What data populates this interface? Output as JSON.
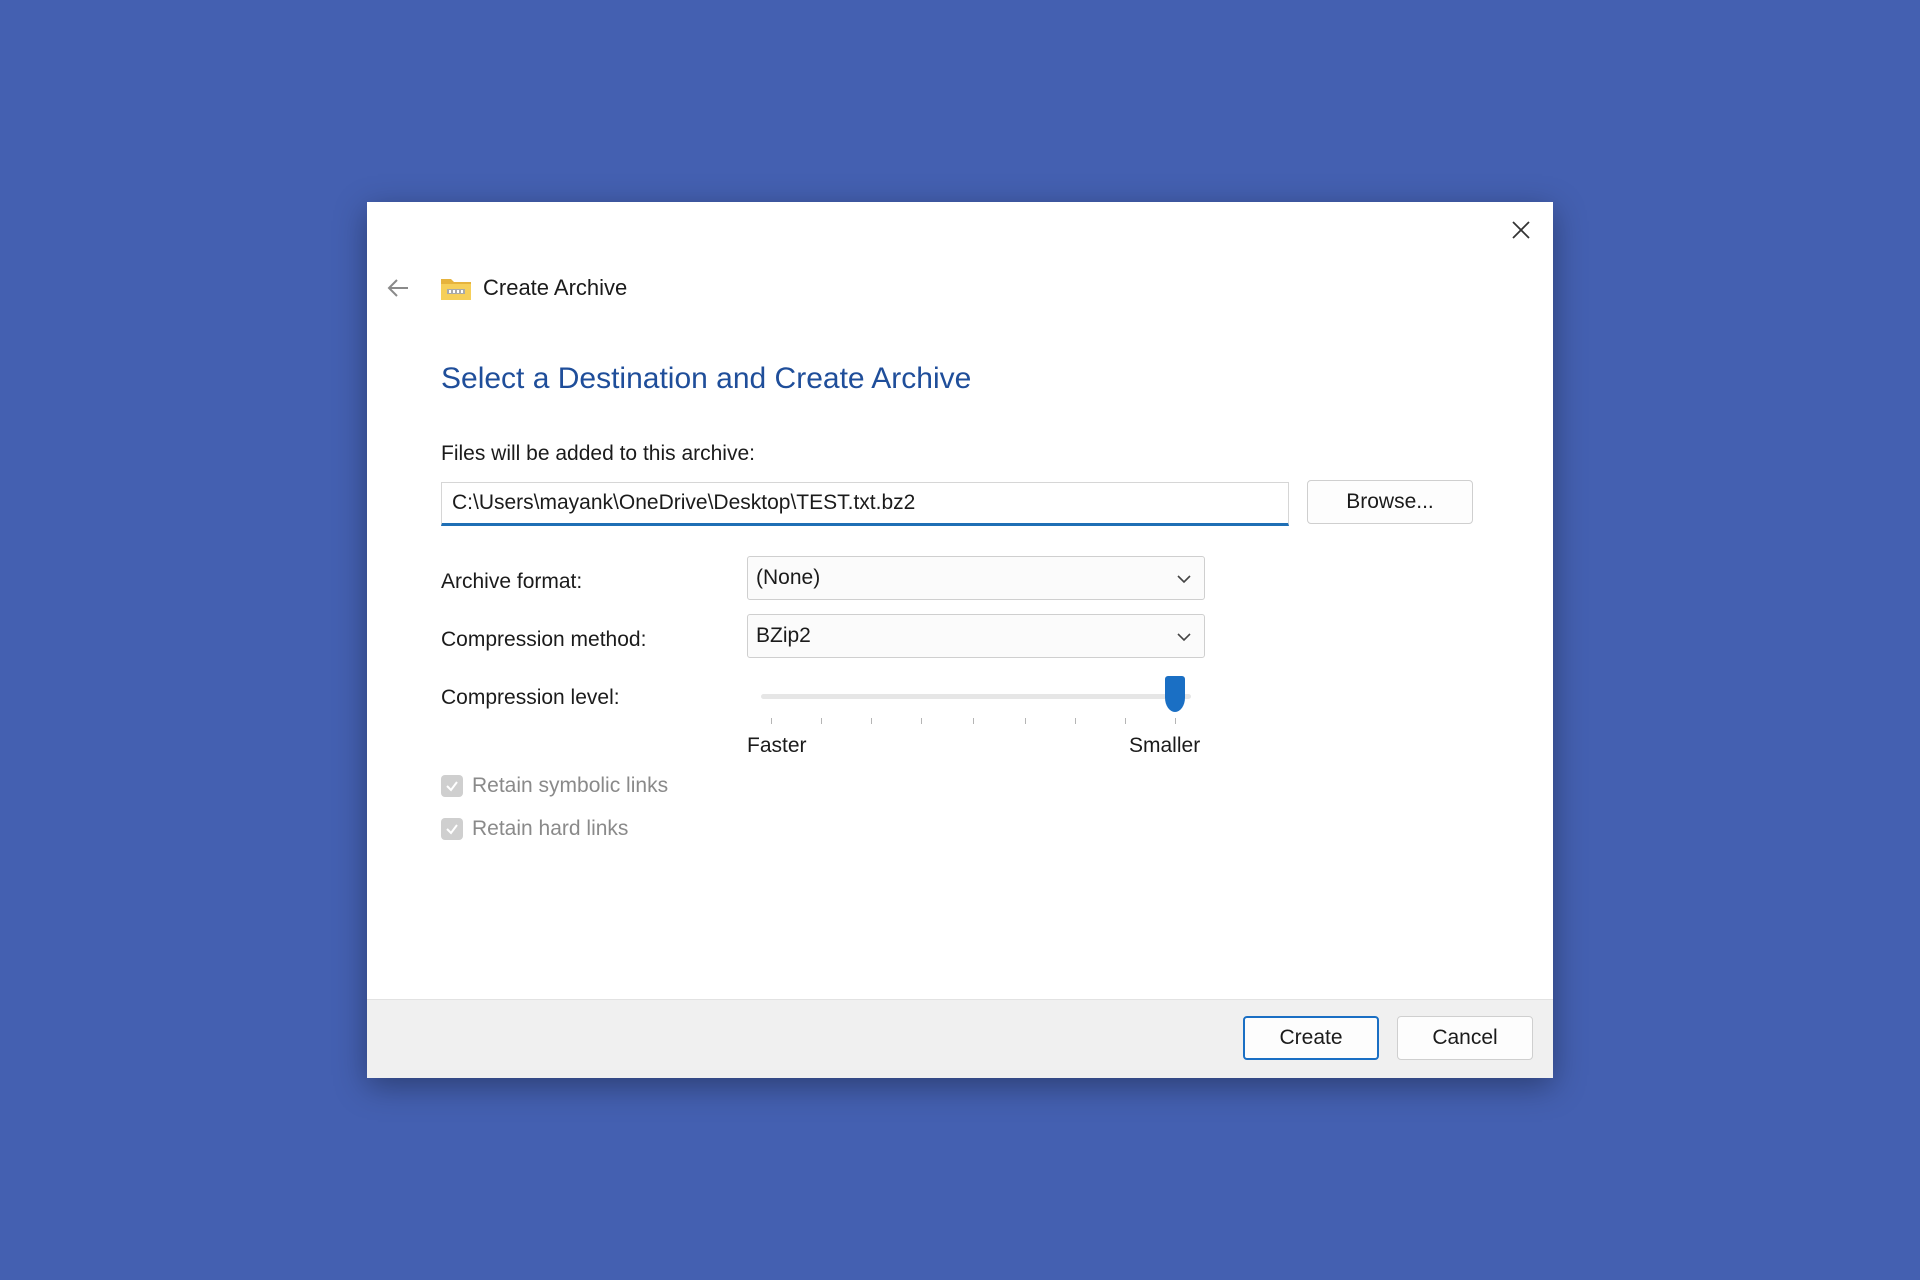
{
  "dialog": {
    "title": "Create Archive",
    "heading": "Select a Destination and Create Archive"
  },
  "destination": {
    "label": "Files will be added to this archive:",
    "path": "C:\\Users\\mayank\\OneDrive\\Desktop\\TEST.txt.bz2",
    "browse_label": "Browse..."
  },
  "archive_format": {
    "label": "Archive format:",
    "selected": "(None)"
  },
  "compression_method": {
    "label": "Compression method:",
    "selected": "BZip2"
  },
  "compression_level": {
    "label": "Compression level:",
    "min_label": "Faster",
    "max_label": "Smaller",
    "value": 9,
    "min": 1,
    "max": 9
  },
  "options": [
    {
      "label": "Retain symbolic links",
      "checked": true,
      "disabled": true
    },
    {
      "label": "Retain hard links",
      "checked": true,
      "disabled": true
    }
  ],
  "actions": {
    "create_label": "Create",
    "cancel_label": "Cancel"
  },
  "colors": {
    "background": "#4460b1",
    "accent": "#1a6fc4",
    "heading": "#1f4e9a"
  }
}
